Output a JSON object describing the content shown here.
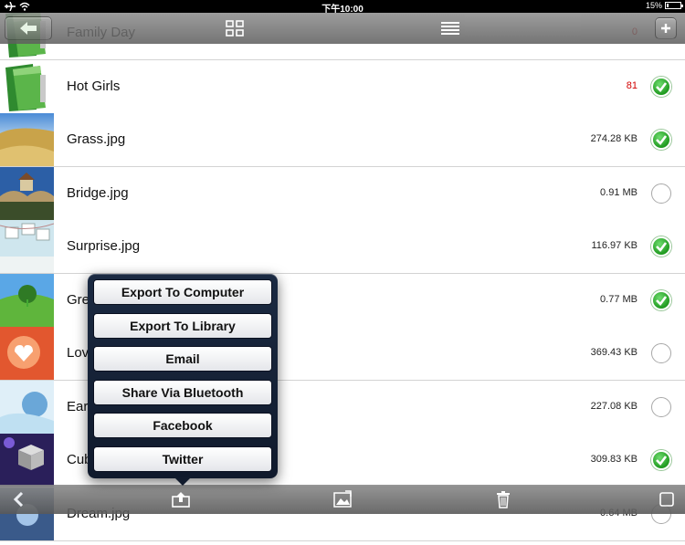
{
  "status_bar": {
    "time": "下午10:00",
    "battery_percent_label": "15%",
    "battery_level": 0.15
  },
  "toolbar_top": {
    "back_icon": "arrow-left-icon",
    "grid_icon": "grid-view-icon",
    "list_icon": "list-view-icon",
    "add_icon": "plus-icon"
  },
  "files": [
    {
      "name": "Family Day",
      "size": "0",
      "size_style": "count",
      "checked": false,
      "thumb": "folder"
    },
    {
      "name": "Hot Girls",
      "size": "81",
      "size_style": "count",
      "checked": true,
      "thumb": "folder"
    },
    {
      "name": "Grass.jpg",
      "size": "274.28 KB",
      "size_style": "size",
      "checked": true,
      "thumb": "grass"
    },
    {
      "name": "Bridge.jpg",
      "size": "0.91 MB",
      "size_style": "size",
      "checked": false,
      "thumb": "bridge"
    },
    {
      "name": "Surprise.jpg",
      "size": "116.97 KB",
      "size_style": "size",
      "checked": true,
      "thumb": "surprise"
    },
    {
      "name": "Gre",
      "size": "0.77 MB",
      "size_style": "size",
      "checked": true,
      "thumb": "green"
    },
    {
      "name": "Lov",
      "size": "369.43 KB",
      "size_style": "size",
      "checked": false,
      "thumb": "love"
    },
    {
      "name": "Ear",
      "size": "227.08 KB",
      "size_style": "size",
      "checked": false,
      "thumb": "earth"
    },
    {
      "name": "Cub",
      "size": "309.83 KB",
      "size_style": "size",
      "checked": true,
      "thumb": "cube"
    },
    {
      "name": "Dream.jpg",
      "size": "0.64 MB",
      "size_style": "size",
      "checked": false,
      "thumb": "dream"
    }
  ],
  "export_menu": {
    "items": [
      "Export To Computer",
      "Export To Library",
      "Email",
      "Share Via Bluetooth",
      "Facebook",
      "Twitter"
    ]
  },
  "toolbar_bottom": {
    "back_icon": "chevron-left-icon",
    "export_icon": "export-icon",
    "move_icon": "image-move-icon",
    "trash_icon": "trash-icon",
    "select_icon": "select-all-checkbox-icon"
  },
  "colors": {
    "count_red": "#d20000",
    "check_green": "#1f9a1f",
    "popover_navy": "#101a2c"
  }
}
